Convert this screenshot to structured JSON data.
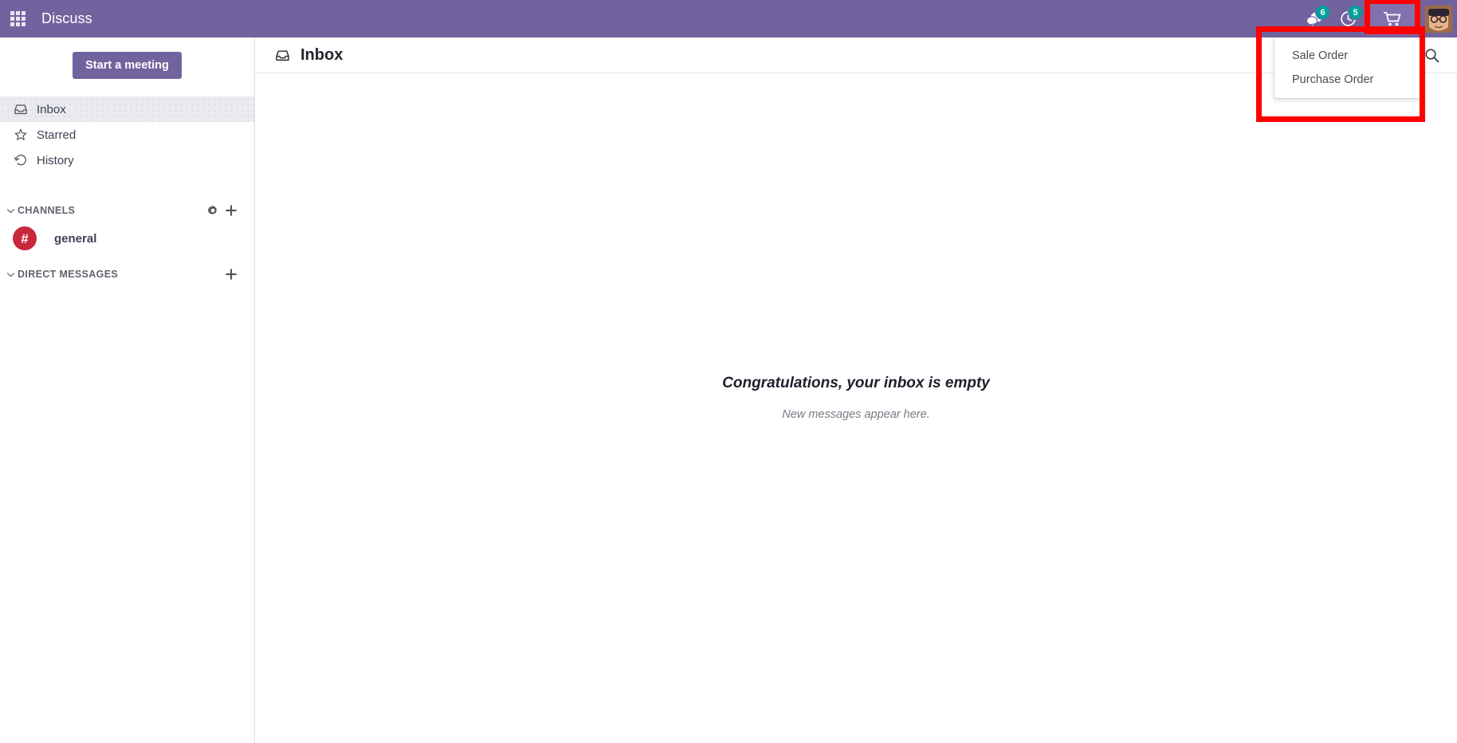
{
  "navbar": {
    "apps_icon": "apps-grid-icon",
    "brand": "Discuss",
    "messages": {
      "icon": "messages-icon",
      "badge": "6"
    },
    "activities": {
      "icon": "activity-clock-icon",
      "badge": "5"
    },
    "cart": {
      "icon": "shopping-cart-icon"
    },
    "avatar": {
      "icon": "user-avatar"
    }
  },
  "dropdown": {
    "items": [
      {
        "label": "Sale Order"
      },
      {
        "label": "Purchase Order"
      }
    ]
  },
  "sidebar": {
    "meeting_button": "Start a meeting",
    "nav_items": [
      {
        "label": "Inbox",
        "icon": "inbox-icon",
        "active": true
      },
      {
        "label": "Starred",
        "icon": "star-icon",
        "active": false
      },
      {
        "label": "History",
        "icon": "history-icon",
        "active": false
      }
    ],
    "channels": {
      "title": "CHANNELS",
      "gear_icon": "gear-icon",
      "add_icon": "plus-icon",
      "chevron": "chevron-down-icon",
      "items": [
        {
          "name": "general",
          "avatar_glyph": "#"
        }
      ]
    },
    "direct_messages": {
      "title": "DIRECT MESSAGES",
      "add_icon": "plus-icon",
      "chevron": "chevron-down-icon",
      "items": []
    }
  },
  "main": {
    "header": {
      "icon": "inbox-icon",
      "title": "Inbox",
      "search_icon": "search-icon"
    },
    "empty_state": {
      "title": "Congratulations, your inbox is empty",
      "subtitle": "New messages appear here."
    }
  },
  "colors": {
    "brand_purple": "#71639e",
    "badge_green": "#00a09d",
    "channel_red": "#c7273b",
    "highlight_red": "#fe0000"
  }
}
